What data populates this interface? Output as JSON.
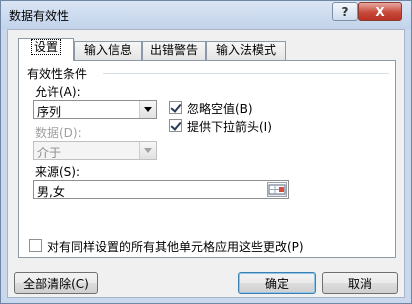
{
  "window": {
    "title": "数据有效性",
    "help_label": "?",
    "close_label": "X"
  },
  "tabs": [
    {
      "label": "设置",
      "active": true
    },
    {
      "label": "输入信息",
      "active": false
    },
    {
      "label": "出错警告",
      "active": false
    },
    {
      "label": "输入法模式",
      "active": false
    }
  ],
  "settings": {
    "group_title": "有效性条件",
    "allow_label": "允许(A):",
    "allow_value": "序列",
    "data_label": "数据(D):",
    "data_value": "介于",
    "ignore_blank_label": "忽略空值(B)",
    "ignore_blank_checked": true,
    "dropdown_label": "提供下拉箭头(I)",
    "dropdown_checked": true,
    "source_label": "来源(S):",
    "source_value": "男,女",
    "apply_all_label": "对有同样设置的所有其他单元格应用这些更改(P)",
    "apply_all_checked": false
  },
  "buttons": {
    "clear_all": "全部清除(C)",
    "ok": "确定",
    "cancel": "取消"
  },
  "icons": {
    "range_selector": "range-select-icon",
    "dropdown": "chevron-down-icon"
  }
}
